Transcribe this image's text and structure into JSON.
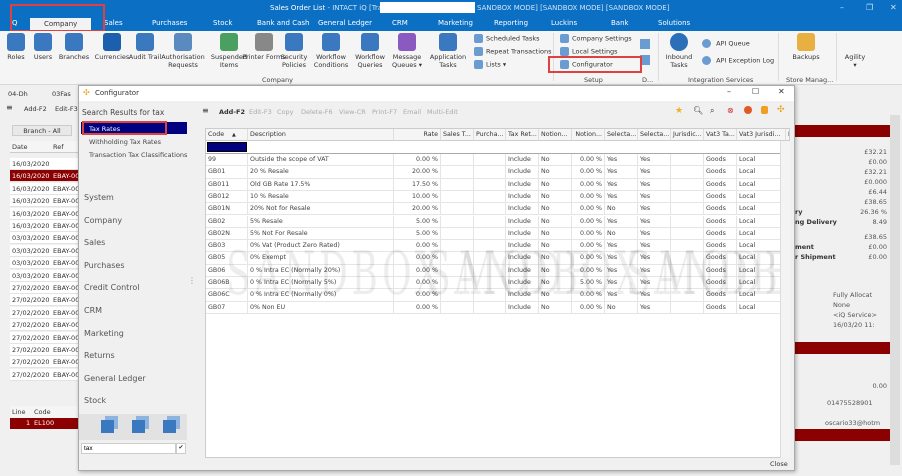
{
  "window": {
    "title": "Sales Order List",
    "subtitle": " - INTACT iQ [Training",
    "sandbox": "SANDBOX MODE] [SANDBOX MODE] [SANDBOX MODE]"
  },
  "tabs": [
    "iQ",
    "Company",
    "Sales",
    "Purchases",
    "Stock",
    "Bank and Cash",
    "General Ledger",
    "CRM",
    "Marketing",
    "Reporting",
    "Luckins",
    "Bank",
    "Solutions"
  ],
  "ribbon": {
    "company_items": [
      "Roles",
      "Users",
      "Branches",
      "Currencies",
      "Audit Trail",
      "Authorisation Requests",
      "Suspended Items",
      "Printer Forms",
      "Security Policies",
      "Workflow Conditions",
      "Workflow Queries",
      "Message Queues ▾",
      "Application Tasks"
    ],
    "tasks": [
      "Scheduled Tasks",
      "Repeat Transactions",
      "Lists ▾"
    ],
    "setup": [
      "Company Settings",
      "Local Settings",
      "Configurator"
    ],
    "integration": [
      "Inbound Tasks",
      "API Queue",
      "API Exception Log"
    ],
    "backups": "Backups",
    "agility": "Agility",
    "groups": {
      "company": "Company",
      "setup": "Setup",
      "d": "D...",
      "integration": "Integration Services",
      "store": "Store Manag..."
    }
  },
  "background": {
    "tabs": [
      "04-Dh",
      "03Fas"
    ],
    "toolbar": [
      "Add-F2",
      "Edit-F3"
    ],
    "branch": "Branch - All",
    "columns": [
      "Date",
      "Ref"
    ],
    "rows": [
      [
        "16/03/2020",
        ""
      ],
      [
        "16/03/2020",
        "EBAY-00"
      ],
      [
        "16/03/2020",
        "EBAY-00"
      ],
      [
        "16/03/2020",
        "EBAY-00"
      ],
      [
        "16/03/2020",
        "EBAY-00"
      ],
      [
        "16/03/2020",
        "EBAY-00"
      ],
      [
        "03/03/2020",
        "EBAY-00"
      ],
      [
        "03/03/2020",
        "EBAY-00"
      ],
      [
        "03/03/2020",
        "EBAY-00"
      ],
      [
        "03/03/2020",
        "EBAY-00"
      ],
      [
        "27/02/2020",
        "EBAY-00"
      ],
      [
        "27/02/2020",
        "EBAY-00"
      ],
      [
        "27/02/2020",
        "EBAY-00"
      ],
      [
        "27/02/2020",
        "EBAY-00"
      ],
      [
        "27/02/2020",
        "EBAY-00"
      ],
      [
        "27/02/2020",
        "EBAY-00"
      ],
      [
        "27/02/2020",
        "EBAY-00"
      ],
      [
        "27/02/2020",
        "EBAY-00"
      ]
    ],
    "lines_columns": [
      "Line",
      "Code"
    ],
    "line_row": [
      "1",
      "EL100"
    ],
    "right_values": [
      "£32.21",
      "£0.00",
      "£32.21",
      "£0.000",
      "£6.44",
      "£38.65",
      "26.36 %",
      "8.49",
      "£38.65",
      "£0.00",
      "£0.00"
    ],
    "right_labels": [
      "ry",
      "ng Delivery",
      "ment",
      "r Shipment"
    ],
    "status": [
      "Fully Allocat",
      "None",
      "<iQ Service>",
      "16/03/20 11:"
    ],
    "zero": "0.00",
    "phone": "01475528901",
    "email": "oscario33@hotm"
  },
  "configurator": {
    "title": "Configurator",
    "search_heading": "Search Results for tax",
    "results": [
      "Tax Rates",
      "Withholding Tax Rates",
      "Transaction Tax Classifications"
    ],
    "categories": [
      "System",
      "Company",
      "Sales",
      "Purchases",
      "Credit Control",
      "CRM",
      "Marketing",
      "Returns",
      "General Ledger",
      "Stock"
    ],
    "search_value": "tax",
    "toolbar": [
      "Add-F2",
      "Edit-F3",
      "Copy",
      "Delete-F6",
      "View-CR",
      "Print-F7",
      "Email",
      "Multi-Edit"
    ],
    "columns": [
      "Code",
      "Description",
      "Rate",
      "Sales T...",
      "Purcha...",
      "Tax Ret...",
      "Notion...",
      "Notion...",
      "Selecta...",
      "Selecta...",
      "Jurisdic...",
      "Vat3 Ta...",
      "Vat3 Jurisdi...",
      "N",
      "D"
    ],
    "rows": [
      [
        "99",
        "Outside the scope of VAT",
        "0.00 %",
        "",
        "",
        "Include",
        "No",
        "0.00 %",
        "Yes",
        "Yes",
        "",
        "Goods",
        "Local",
        "",
        ""
      ],
      [
        "GB01",
        "20 % Resale",
        "20.00 %",
        "",
        "",
        "Include",
        "No",
        "0.00 %",
        "Yes",
        "Yes",
        "",
        "Goods",
        "Local",
        "",
        ""
      ],
      [
        "GB011",
        "Old GB Rate 17.5%",
        "17.50 %",
        "",
        "",
        "Include",
        "No",
        "0.00 %",
        "Yes",
        "Yes",
        "",
        "Goods",
        "Local",
        "",
        ""
      ],
      [
        "GB012",
        "10 % Resale",
        "10.00 %",
        "",
        "",
        "Include",
        "No",
        "0.00 %",
        "Yes",
        "Yes",
        "",
        "Goods",
        "Local",
        "",
        ""
      ],
      [
        "GB01N",
        "20%  Not for Resale",
        "20.00 %",
        "",
        "",
        "Include",
        "No",
        "0.00 %",
        "No",
        "Yes",
        "",
        "Goods",
        "Local",
        "",
        ""
      ],
      [
        "GB02",
        "5% Resale",
        "5.00 %",
        "",
        "",
        "Include",
        "No",
        "0.00 %",
        "Yes",
        "Yes",
        "",
        "Goods",
        "Local",
        "",
        ""
      ],
      [
        "GB02N",
        "5% Not For Resale",
        "5.00 %",
        "",
        "",
        "Include",
        "No",
        "0.00 %",
        "No",
        "Yes",
        "",
        "Goods",
        "Local",
        "",
        ""
      ],
      [
        "GB03",
        "0% Vat (Product Zero Rated)",
        "0.00 %",
        "",
        "",
        "Include",
        "No",
        "0.00 %",
        "Yes",
        "Yes",
        "",
        "Goods",
        "Local",
        "",
        ""
      ],
      [
        "GB05",
        "0% Exempt",
        "0.00 %",
        "",
        "",
        "Include",
        "No",
        "0.00 %",
        "Yes",
        "Yes",
        "",
        "Goods",
        "Local",
        "",
        ""
      ],
      [
        "GB06",
        "0 % Intra EC (Normally 20%)",
        "0.00 %",
        "",
        "",
        "Include",
        "No",
        "0.00 %",
        "Yes",
        "Yes",
        "",
        "Goods",
        "Local",
        "",
        ""
      ],
      [
        "GB06B",
        "0 % Intra EC (Normally 5%)",
        "0.00 %",
        "",
        "",
        "Include",
        "No",
        "5.00 %",
        "Yes",
        "Yes",
        "",
        "Goods",
        "Local",
        "",
        ""
      ],
      [
        "GB06C",
        "0 % Intra EC (Normally 0%)",
        "0.00 %",
        "",
        "",
        "Include",
        "No",
        "0.00 %",
        "Yes",
        "Yes",
        "",
        "Goods",
        "Local",
        "",
        ""
      ],
      [
        "GB07",
        "0% Non EU",
        "0.00 %",
        "",
        "",
        "Include",
        "No",
        "0.00 %",
        "No",
        "Yes",
        "",
        "Goods",
        "Local",
        "",
        ""
      ]
    ],
    "close": "Close",
    "watermark": "SANDBOX MODE"
  },
  "colors": {
    "brand": "#0b6fc4",
    "selected": "#000080",
    "highlight": "#8b0000",
    "annotation": "#e0403f"
  }
}
